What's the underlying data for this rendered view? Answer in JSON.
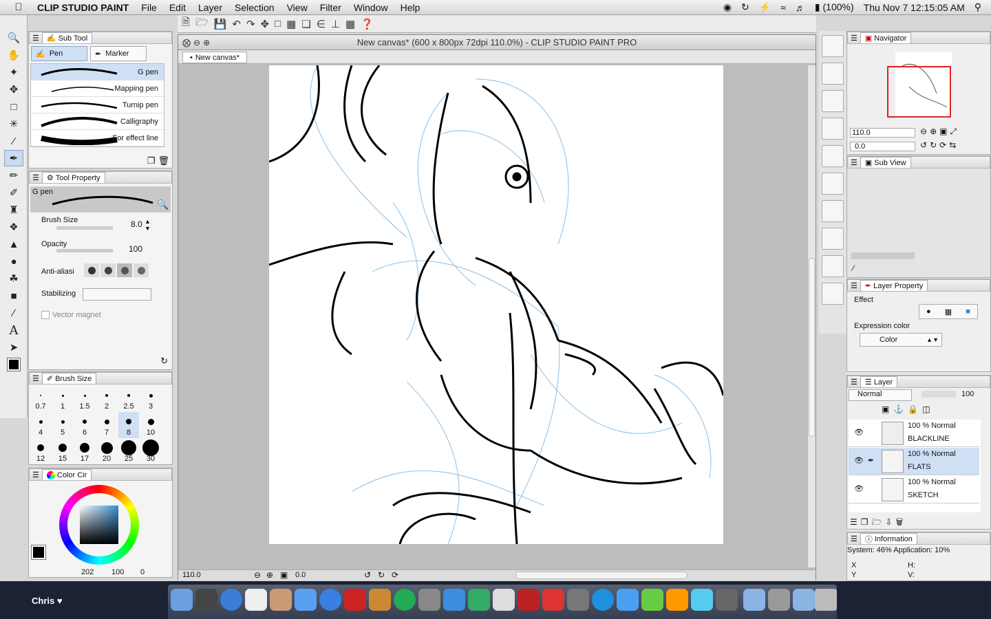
{
  "menubar": {
    "app": "CLIP STUDIO PAINT",
    "items": [
      "File",
      "Edit",
      "Layer",
      "Selection",
      "View",
      "Filter",
      "Window",
      "Help"
    ],
    "battery": "(100%)",
    "clock": "Thu Nov 7  12:15:05 AM"
  },
  "subtool": {
    "title": "Sub Tool",
    "tabs": [
      "Pen",
      "Marker"
    ],
    "brushes": [
      "G pen",
      "Mapping pen",
      "Turnip pen",
      "Calligraphy",
      "For effect line"
    ]
  },
  "toolprop": {
    "title": "Tool Property",
    "brush_name": "G pen",
    "brush_size_label": "Brush Size",
    "brush_size": "8.0",
    "opacity_label": "Opacity",
    "opacity": "100",
    "antialias_label": "Anti-aliasi",
    "stabilizing_label": "Stabilizing",
    "vector_label": "Vector magnet"
  },
  "brushsize": {
    "title": "Brush Size",
    "sizes": [
      "0.7",
      "1",
      "1.5",
      "2",
      "2.5",
      "3",
      "4",
      "5",
      "6",
      "7",
      "8",
      "10",
      "12",
      "15",
      "17",
      "20",
      "25",
      "30"
    ],
    "selected": "8"
  },
  "colorpanel": {
    "title": "Color Cir",
    "readout_a": "202",
    "readout_b": "100",
    "readout_c": "0"
  },
  "canvas": {
    "title": "New canvas* (600 x 800px 72dpi 110.0%)  - CLIP STUDIO PAINT PRO",
    "tab": "New canvas*",
    "zoom": "110.0",
    "rotation": "0.0"
  },
  "navigator": {
    "title": "Navigator",
    "zoom": "110.0",
    "rotation": "0.0"
  },
  "subview": {
    "title": "Sub View"
  },
  "layerprop": {
    "title": "Layer Property",
    "effect_label": "Effect",
    "expression_label": "Expression color",
    "expression_value": "Color"
  },
  "layers": {
    "title": "Layer",
    "blend": "Normal",
    "opacity": "100",
    "items": [
      {
        "mode": "100 % Normal",
        "name": "BLACKLINE"
      },
      {
        "mode": "100 % Normal",
        "name": "FLATS"
      },
      {
        "mode": "100 % Normal",
        "name": "SKETCH"
      }
    ]
  },
  "info": {
    "title": "Information",
    "system": "System: 46% Application: 10%",
    "x": "X",
    "y": "Y",
    "h": "H:",
    "v": "V:"
  },
  "dock": {
    "user": "Chris ♥"
  },
  "colors": {
    "accent": "#c9d9ee",
    "sketch": "#8fc4ec"
  }
}
